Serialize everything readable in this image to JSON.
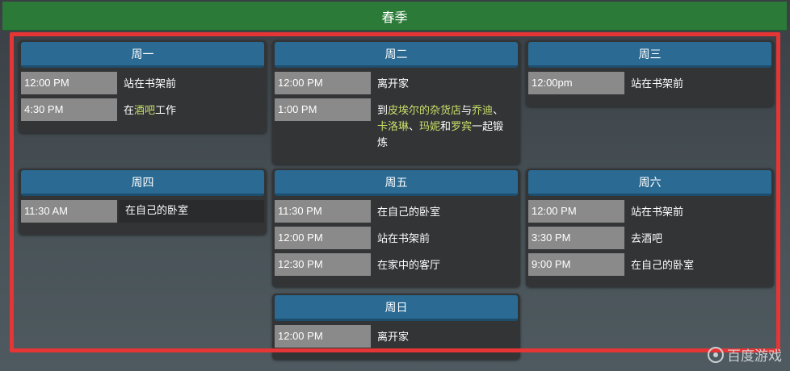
{
  "season": {
    "title": "春季"
  },
  "days": {
    "mon": {
      "label": "周一",
      "rows": [
        {
          "time": "12:00 PM",
          "text": "站在书架前"
        },
        {
          "time": "4:30 PM",
          "pre": "在",
          "hl": "酒吧",
          "post": "工作"
        }
      ]
    },
    "tue": {
      "label": "周二",
      "rows": [
        {
          "time": "12:00 PM",
          "text": "离开家"
        },
        {
          "time": "1:00 PM",
          "line1_pre": "到",
          "line1_hl": "皮埃尔的杂货店",
          "line1_mid": "与",
          "line1_hl2": "乔迪",
          "line1_end": "、",
          "line2_hl1": "卡洛琳",
          "line2_sep1": "、",
          "line2_hl2": "玛妮",
          "line2_sep2": "和",
          "line2_hl3": "罗宾",
          "line2_end": "一起锻",
          "line3": "炼"
        }
      ]
    },
    "wed": {
      "label": "周三",
      "rows": [
        {
          "time": "12:00pm",
          "text": "站在书架前"
        }
      ]
    },
    "thu": {
      "label": "周四",
      "rows": [
        {
          "time": "11:30 AM",
          "text": "在自己的卧室"
        }
      ]
    },
    "fri": {
      "label": "周五",
      "rows": [
        {
          "time": "11:30 PM",
          "text": "在自己的卧室"
        },
        {
          "time": "12:00 PM",
          "text": "站在书架前"
        },
        {
          "time": "12:30 PM",
          "text": "在家中的客厅"
        }
      ]
    },
    "sat": {
      "label": "周六",
      "rows": [
        {
          "time": "12:00 PM",
          "text": "站在书架前"
        },
        {
          "time": "3:30 PM",
          "text": "去酒吧"
        },
        {
          "time": "9:00 PM",
          "text": "在自己的卧室"
        }
      ]
    },
    "sun": {
      "label": "周日",
      "rows": [
        {
          "time": "12:00 PM",
          "text": "离开家"
        }
      ]
    }
  },
  "watermark": {
    "text": "百度游戏",
    "icon": "baidu-game-logo-icon"
  },
  "colors": {
    "season_bar": "#2b7a37",
    "day_header": "#2a6a93",
    "highlight_text": "#c8e06a",
    "annotation_box": "#e53535"
  }
}
